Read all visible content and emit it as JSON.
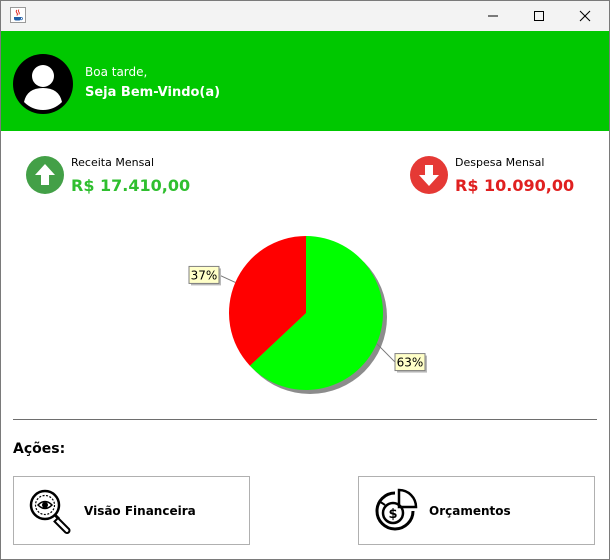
{
  "window": {
    "app_icon": "java-cup-icon",
    "controls": [
      "minimize-icon",
      "maximize-icon",
      "close-icon"
    ]
  },
  "header": {
    "greeting": "Boa tarde,",
    "welcome": "Seja Bem-Vindo(a)",
    "background_color": "#00c800"
  },
  "summary": {
    "receita": {
      "label": "Receita Mensal",
      "value": "R$ 17.410,00",
      "color": "#2fbf2f",
      "icon": "arrow-up-icon"
    },
    "despesa": {
      "label": "Despesa Mensal",
      "value": "R$ 10.090,00",
      "color": "#e02020",
      "icon": "arrow-down-icon"
    }
  },
  "chart_data": {
    "type": "pie",
    "slices": [
      {
        "label": "63%",
        "value": 63,
        "color": "#00ff00"
      },
      {
        "label": "37%",
        "value": 37,
        "color": "#ff0000"
      }
    ]
  },
  "actions": {
    "title": "Ações:",
    "visao": {
      "label": "Visão Financeira",
      "icon": "magnifier-money-icon"
    },
    "orcamentos": {
      "label": "Orçamentos",
      "icon": "budget-chart-icon"
    }
  }
}
